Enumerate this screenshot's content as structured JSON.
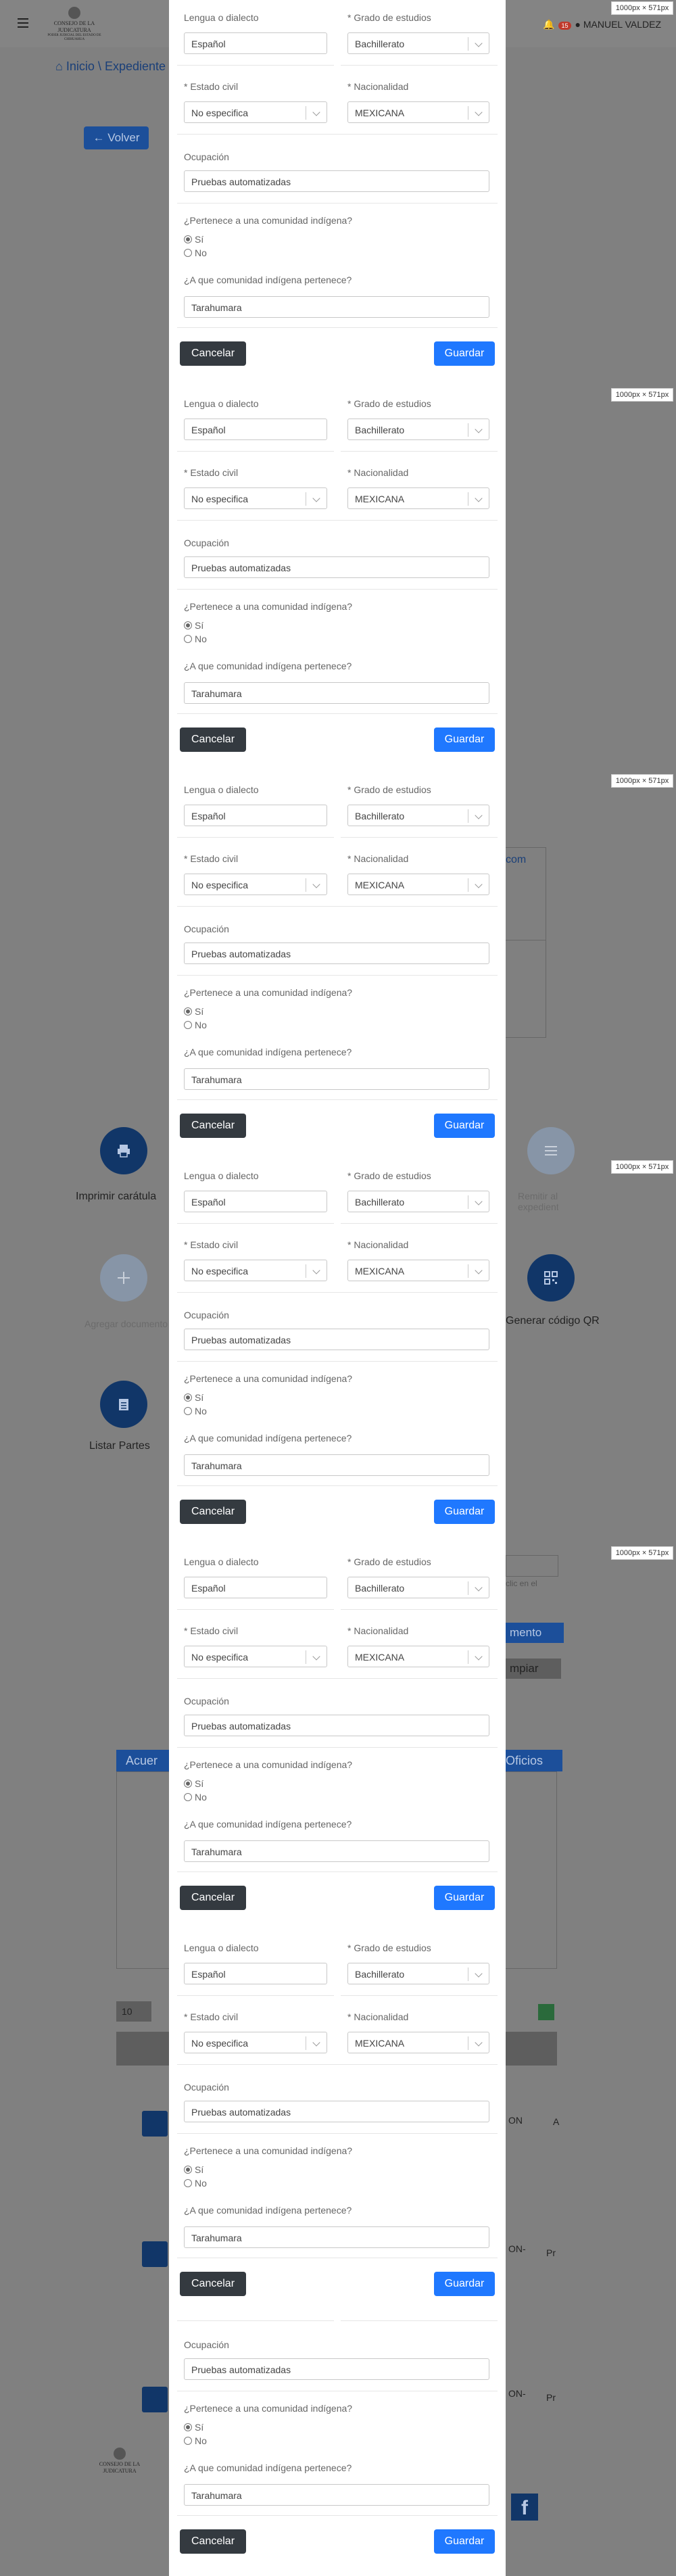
{
  "header": {
    "logo_title": "CONSEJO DE LA JUDICATURA",
    "logo_subtitle": "PODER JUDICIAL DEL ESTADO DE CHIHUAHUA",
    "notification_count": "15",
    "user_name": "MANUEL VALDEZ"
  },
  "background": {
    "breadcrumb_home": "Inicio",
    "breadcrumb_section": "Expediente",
    "back_button": "Volver",
    "link_fragment": "com",
    "print_cover": "Imprimir carátula",
    "attach_label": "Remitir al expediente",
    "add_label": "Agregar documento",
    "qr_label": "Generar código QR",
    "list_parties": "Listar Partes",
    "input_hint": "clic en el",
    "doc_button": "mento",
    "clear_button": "mpiar",
    "tab_acuerdos": "Acuer",
    "tab_oficios": "Oficios",
    "per_page": "10",
    "row_text_1": "ON",
    "row_text_2": "ON-",
    "row_text_3": "Pr",
    "row_text_4": "A",
    "footer_logo": "CONSEJO DE LA JUDICATURA",
    "facebook": "f"
  },
  "form": {
    "labels": {
      "language": "Lengua o dialecto",
      "education": "Grado de estudios",
      "civil_status": "Estado civil",
      "nationality": "Nacionalidad",
      "occupation": "Ocupación",
      "indigenous_question": "¿Pertenece a una comunidad indígena?",
      "yes": "Sí",
      "no": "No",
      "community_question": "¿A que comunidad indígena pertenece?",
      "required_mark": "*"
    },
    "values": {
      "language": "Español",
      "education": "Bachillerato",
      "civil_status": "No especifica",
      "nationality": "MEXICANA",
      "occupation": "Pruebas automatizadas",
      "community": "Tarahumara",
      "indigenous_selected": "yes"
    },
    "buttons": {
      "cancel": "Cancelar",
      "save": "Guardar"
    }
  },
  "dimension_badge": "1000px × 571px"
}
